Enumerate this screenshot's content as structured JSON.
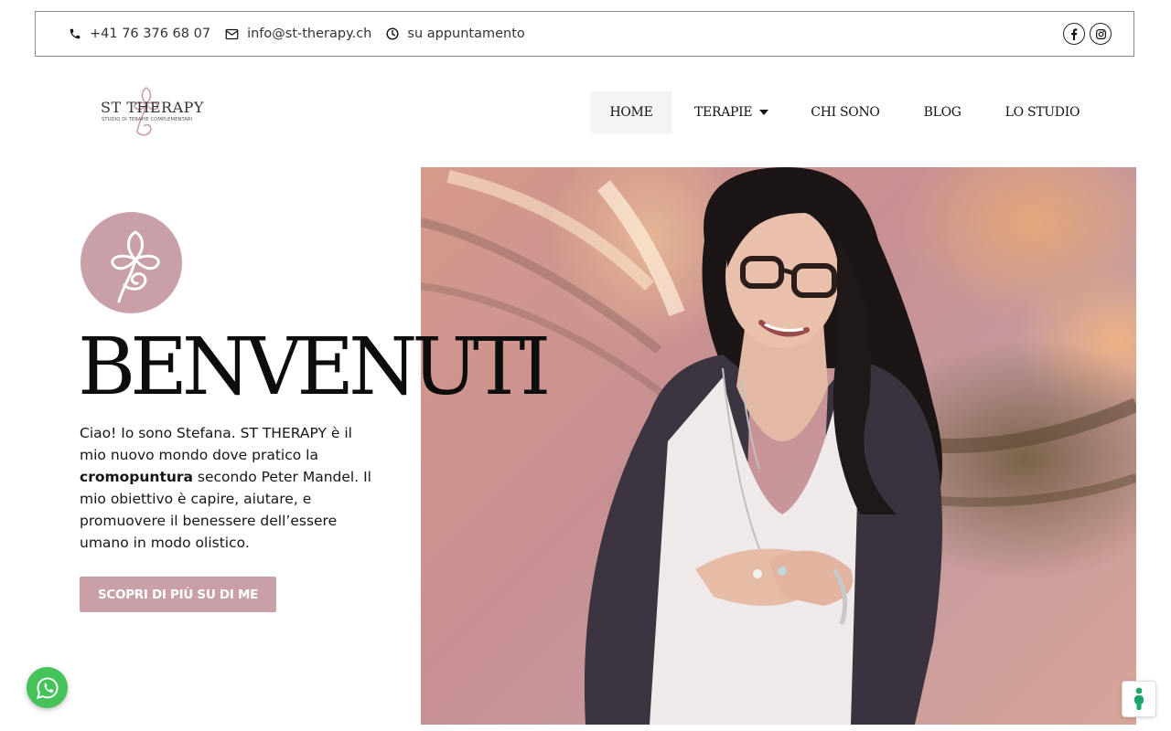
{
  "topbar": {
    "phone": "+41 76 376 68 07",
    "email": "info@st-therapy.ch",
    "hours": "su appuntamento",
    "social": [
      {
        "name": "facebook",
        "icon": "facebook-icon"
      },
      {
        "name": "instagram",
        "icon": "instagram-icon"
      }
    ]
  },
  "logo": {
    "title": "ST THERAPY",
    "subtitle": "STUDIO DI TERAPIE COMPLEMENTARI"
  },
  "nav": {
    "items": [
      {
        "label": "HOME",
        "active": true
      },
      {
        "label": "TERAPIE",
        "has_dropdown": true
      },
      {
        "label": "CHI SONO"
      },
      {
        "label": "BLOG"
      },
      {
        "label": "LO STUDIO"
      }
    ]
  },
  "hero": {
    "title": "BENVENUTI",
    "text_before": "Ciao! Io sono Stefana. ST THERAPY è il mio nuovo mondo dove pratico la ",
    "text_bold": "cromopuntura",
    "text_after": " secondo Peter Mandel. Il mio obiettivo è capire, aiutare, e promuovere il benessere dell’essere umano in modo olistico.",
    "cta_label": "SCOPRI DI PIÙ SU DI ME"
  },
  "widgets": {
    "chat_icon": "whatsapp-icon",
    "accessibility_icon": "accessibility-icon"
  },
  "colors": {
    "accent": "#c9a0a8",
    "whatsapp": "#45c35a",
    "accessibility": "#1aa56a",
    "text": "#111111"
  }
}
